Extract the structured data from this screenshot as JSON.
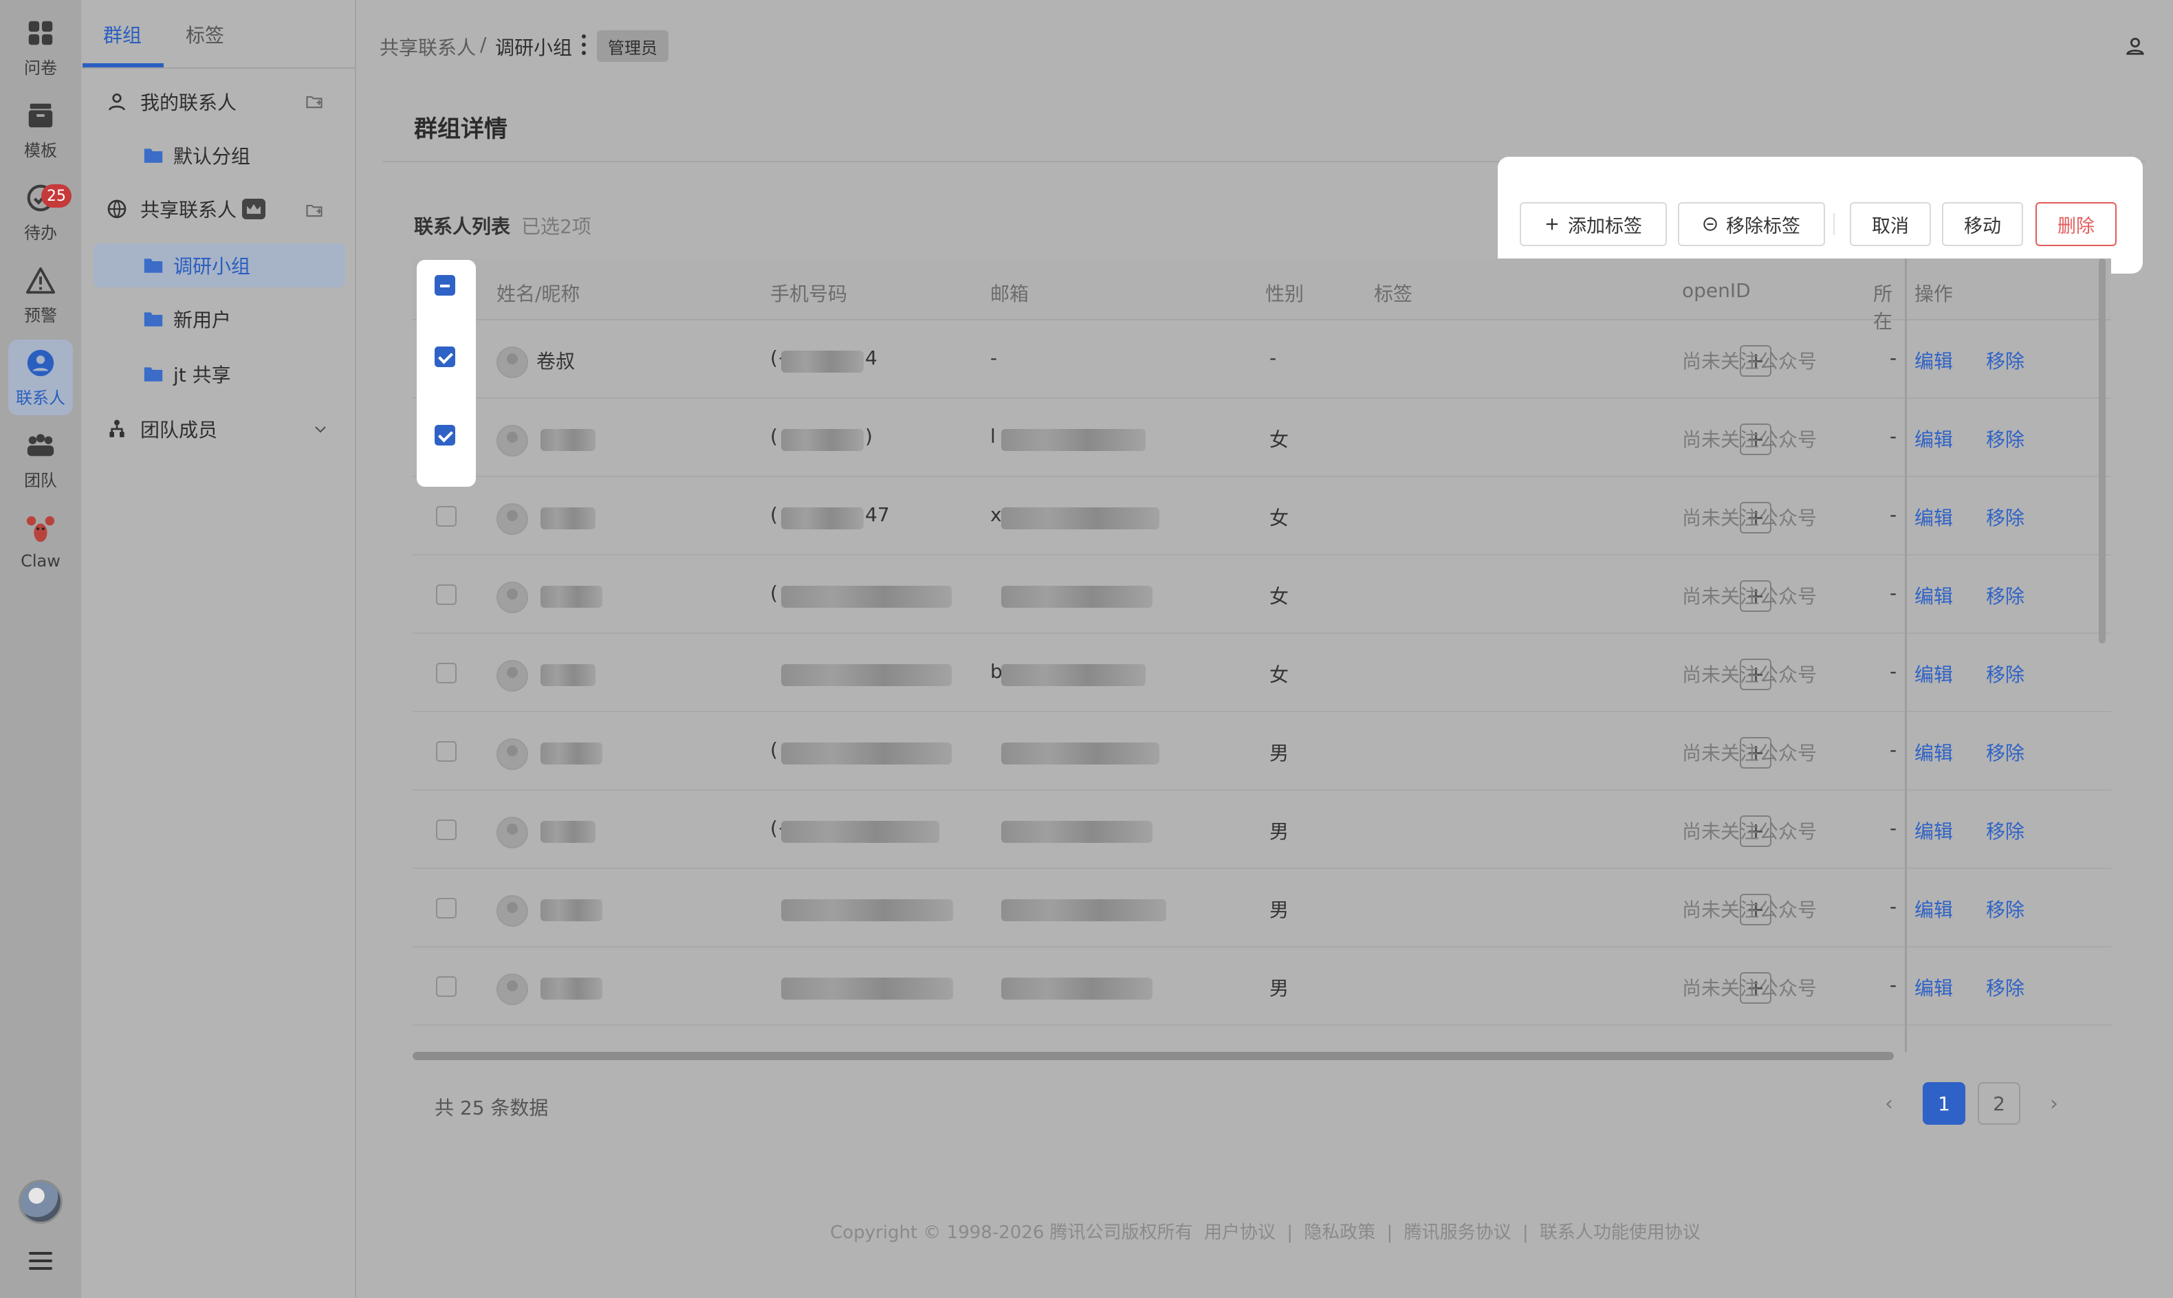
{
  "rail": {
    "items": [
      {
        "label": "问卷",
        "icon": "grid-icon"
      },
      {
        "label": "模板",
        "icon": "template-icon"
      },
      {
        "label": "待办",
        "icon": "todo-check-icon",
        "badge": "25"
      },
      {
        "label": "预警",
        "icon": "warning-icon"
      },
      {
        "label": "联系人",
        "icon": "contact-icon",
        "active": true
      },
      {
        "label": "团队",
        "icon": "team-icon"
      },
      {
        "label": "Claw",
        "icon": "lobster-icon"
      }
    ],
    "avatar_icon": "user-avatar",
    "menu_icon": "hamburger-icon"
  },
  "sidebar": {
    "tabs": [
      "群组",
      "标签"
    ],
    "active_tab": "群组",
    "my_contacts": "我的联系人",
    "default_group": "默认分组",
    "shared_contacts": "共享联系人",
    "groups": [
      "调研小组",
      "新用户",
      "jt 共享"
    ],
    "selected_group": "调研小组",
    "team_members": "团队成员"
  },
  "header": {
    "breadcrumb_root": "共享联系人",
    "breadcrumb_sep": "/",
    "breadcrumb_current": "调研小组",
    "role_tag": "管理员"
  },
  "page": {
    "title": "群组详情",
    "list_title": "联系人列表",
    "selected_count": "已选2项"
  },
  "toolbar": {
    "add_tag": "添加标签",
    "remove_tag": "移除标签",
    "cancel": "取消",
    "move": "移动",
    "delete": "删除"
  },
  "table": {
    "columns": [
      "姓名/昵称",
      "手机号码",
      "邮箱",
      "性别",
      "标签",
      "openID",
      "所在",
      "操作"
    ],
    "rows": [
      {
        "name": "卷叔",
        "phone": "(+",
        "phone_tail": "4",
        "email": "-",
        "gender": "-",
        "openid": "尚未关注公众号",
        "location": "-",
        "edit": "编辑",
        "remove": "移除",
        "checked": true
      },
      {
        "name": "",
        "phone": "(",
        "phone_tail": ")",
        "email": "l",
        "gender": "女",
        "openid": "尚未关注公众号",
        "location": "-",
        "edit": "编辑",
        "remove": "移除",
        "checked": true
      },
      {
        "name": "",
        "phone": "(",
        "phone_tail": "47",
        "email": "x",
        "gender": "女",
        "openid": "尚未关注公众号",
        "location": "-",
        "edit": "编辑",
        "remove": "移除",
        "checked": false
      },
      {
        "name": "",
        "phone": "(",
        "phone_tail": "",
        "email": "",
        "gender": "女",
        "openid": "尚未关注公众号",
        "location": "-",
        "edit": "编辑",
        "remove": "移除",
        "checked": false
      },
      {
        "name": "",
        "phone": "",
        "phone_tail": "",
        "email": "b",
        "gender": "女",
        "openid": "尚未关注公众号",
        "location": "-",
        "edit": "编辑",
        "remove": "移除",
        "checked": false
      },
      {
        "name": "",
        "phone": "(",
        "phone_tail": "",
        "email": "",
        "gender": "男",
        "openid": "尚未关注公众号",
        "location": "-",
        "edit": "编辑",
        "remove": "移除",
        "checked": false
      },
      {
        "name": "",
        "phone": "(+",
        "phone_tail": "",
        "email": "",
        "gender": "男",
        "openid": "尚未关注公众号",
        "location": "-",
        "edit": "编辑",
        "remove": "移除",
        "checked": false
      },
      {
        "name": "",
        "phone": "",
        "phone_tail": "",
        "email": "",
        "gender": "男",
        "openid": "尚未关注公众号",
        "location": "-",
        "edit": "编辑",
        "remove": "移除",
        "checked": false
      },
      {
        "name": "",
        "phone": "",
        "phone_tail": "",
        "email": "",
        "gender": "男",
        "openid": "尚未关注公众号",
        "location": "-",
        "edit": "编辑",
        "remove": "移除",
        "checked": false
      }
    ]
  },
  "pagination": {
    "total": "共 25 条数据",
    "pages": [
      "1",
      "2"
    ],
    "current": "1",
    "prev": "‹",
    "next": "›"
  },
  "footer": {
    "copyright": "Copyright © 1998-2026 腾讯公司版权所有",
    "links": [
      "用户协议",
      "隐私政策",
      "腾讯服务协议",
      "联系人功能使用协议"
    ],
    "sep": "|"
  },
  "colors": {
    "accent": "#2f62c6",
    "danger": "#e25c5c",
    "badge": "#c53a3a"
  }
}
